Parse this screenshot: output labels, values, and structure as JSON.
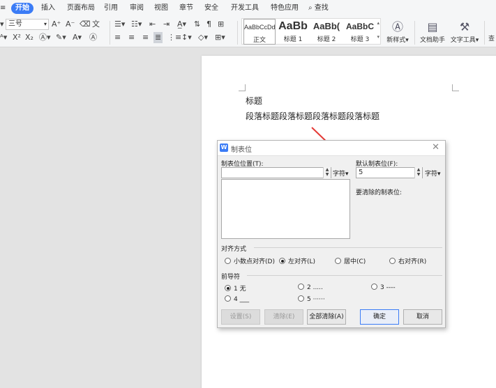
{
  "menubar": {
    "items": [
      "开始",
      "插入",
      "页面布局",
      "引用",
      "审阅",
      "视图",
      "章节",
      "安全",
      "开发工具",
      "特色应用"
    ],
    "search": "查找"
  },
  "ribbon": {
    "font_size": "三号",
    "styles": [
      {
        "preview": "AaBbCcDd",
        "name": "正文"
      },
      {
        "preview": "AaBb",
        "name": "标题 1"
      },
      {
        "preview": "AaBb(",
        "name": "标题 2"
      },
      {
        "preview": "AaBbC",
        "name": "标题 3"
      }
    ],
    "new_style": "新样式",
    "doc_helper": "文档助手",
    "text_tools": "文字工具"
  },
  "document": {
    "title": "标题",
    "paragraph": "段落标题段落标题段落标题段落标题"
  },
  "dialog": {
    "title": "制表位",
    "tab_position_label": "制表位位置(T):",
    "tab_position_value": "",
    "unit": "字符",
    "default_tab_label": "默认制表位(F):",
    "default_tab_value": "5",
    "clear_label": "要清除的制表位:",
    "align_label": "对齐方式",
    "align_options": [
      "小数点对齐(D)",
      "左对齐(L)",
      "居中(C)",
      "右对齐(R)"
    ],
    "leader_label": "前导符",
    "leader_options": [
      "1 无",
      "2 .....",
      "3 ----",
      "4 ___",
      "5 ······"
    ],
    "buttons": {
      "set": "设置(S)",
      "clear": "清除(E)",
      "clear_all": "全部清除(A)",
      "ok": "确定",
      "cancel": "取消"
    }
  },
  "colors": {
    "accent": "#3b7cf6",
    "annotation_arrow": "#e53935"
  }
}
